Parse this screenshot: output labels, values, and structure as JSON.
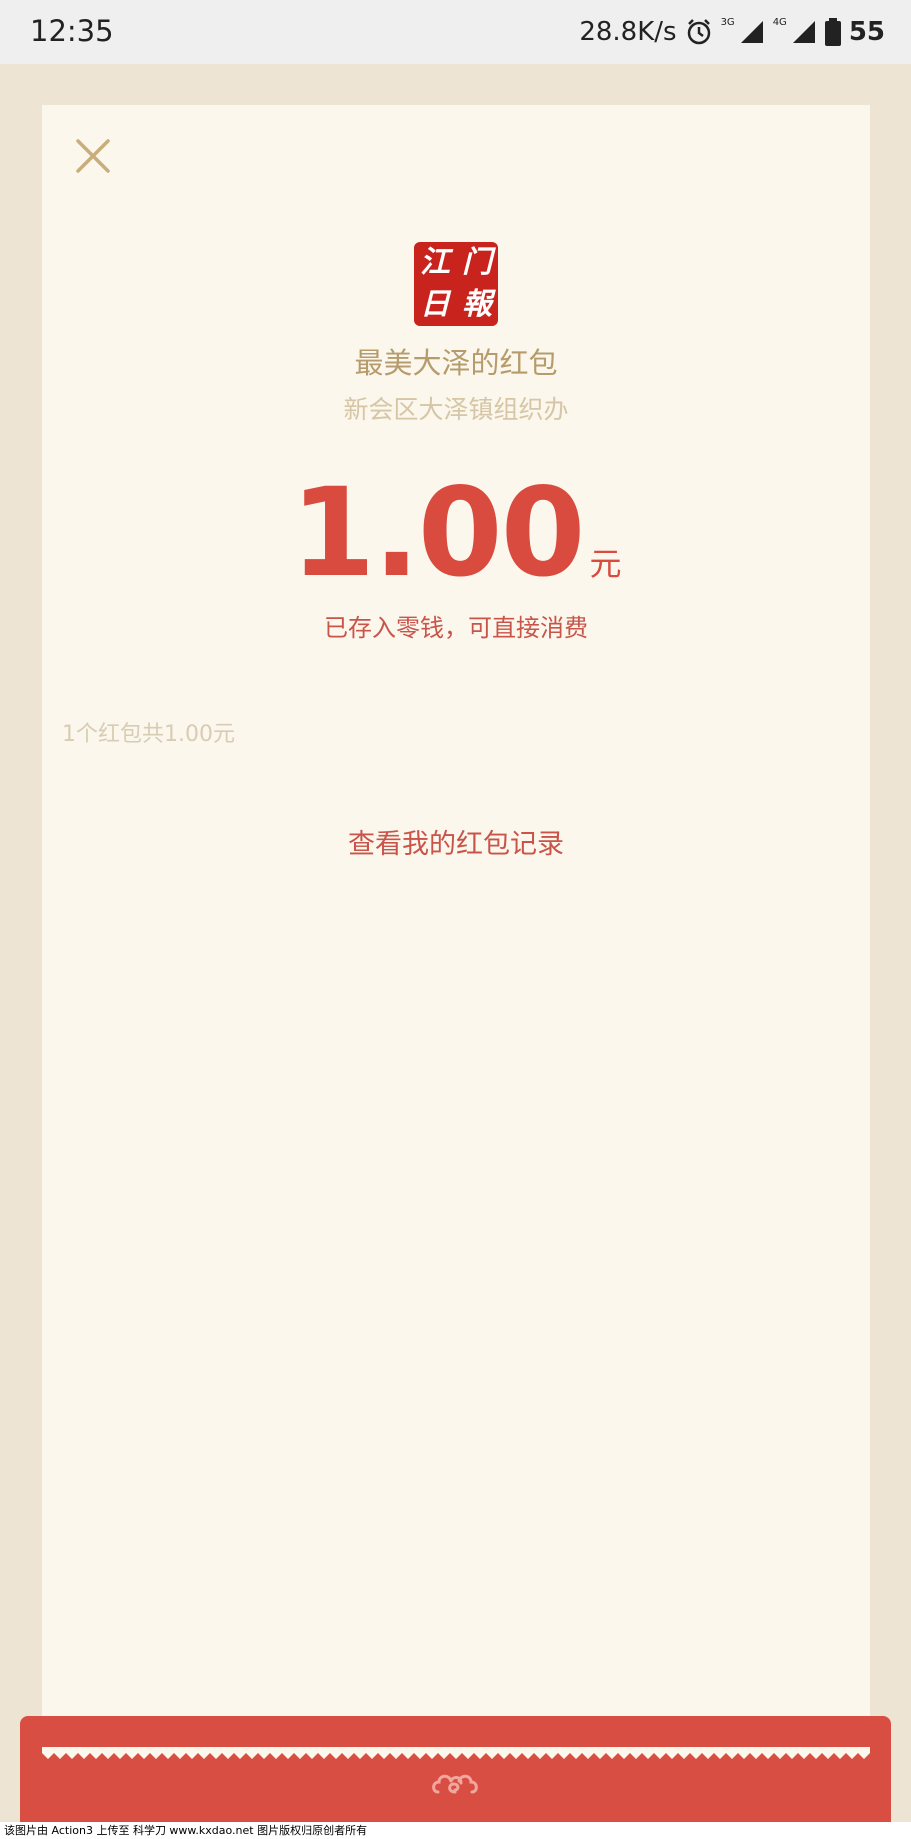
{
  "status_bar": {
    "time": "12:35",
    "speed": "28.8K/s",
    "network1": "3G",
    "network2": "4G",
    "battery": "55",
    "icons": [
      "alarm-icon",
      "signal-icon",
      "battery-icon"
    ]
  },
  "card": {
    "close_icon": "close-icon",
    "logo_chars": [
      "江",
      "门",
      "日",
      "報"
    ],
    "title": "最美大泽的红包",
    "org": "新会区大泽镇组织办",
    "amount": "1.00",
    "unit": "元",
    "note": "已存入零钱，可直接消费",
    "summary": "1个红包共1.00元",
    "record_link": "查看我的红包记录"
  },
  "watermark": "该图片由 Action3 上传至 科学刀 www.kxdao.net 图片版权归原创者所有",
  "colors": {
    "accent_red": "#d94a3f",
    "gold": "#b69c6c",
    "card_bg": "#fbf7ec",
    "page_bg": "#ede4d3"
  }
}
